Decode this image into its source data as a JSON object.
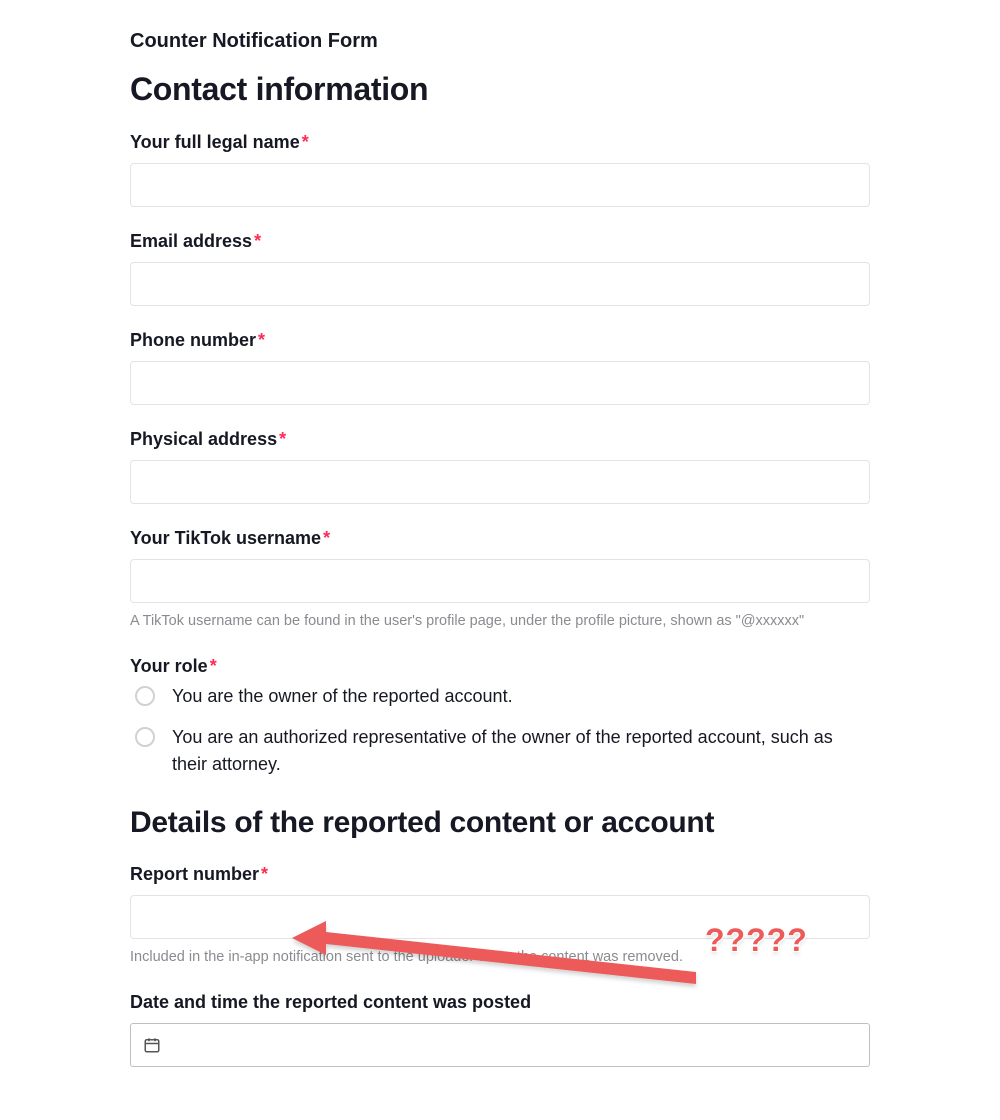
{
  "formTitle": "Counter Notification Form",
  "section1": "Contact information",
  "section2": "Details of the reported content or account",
  "asterisk": "*",
  "fields": {
    "fullName": {
      "label": "Your full legal name"
    },
    "email": {
      "label": "Email address"
    },
    "phone": {
      "label": "Phone number"
    },
    "address": {
      "label": "Physical address"
    },
    "username": {
      "label": "Your TikTok username",
      "helper": "A TikTok username can be found in the user's profile page, under the profile picture, shown as \"@xxxxxx\""
    },
    "role": {
      "label": "Your role",
      "options": [
        "You are the owner of the reported account.",
        "You are an authorized representative of the owner of the reported account, such as their attorney."
      ]
    },
    "reportNumber": {
      "label": "Report number",
      "helper": "Included in the in-app notification sent to the uploader when the content was removed."
    },
    "dateTime": {
      "label": "Date and time the reported content was posted"
    }
  },
  "annotation": {
    "text": "?????"
  }
}
